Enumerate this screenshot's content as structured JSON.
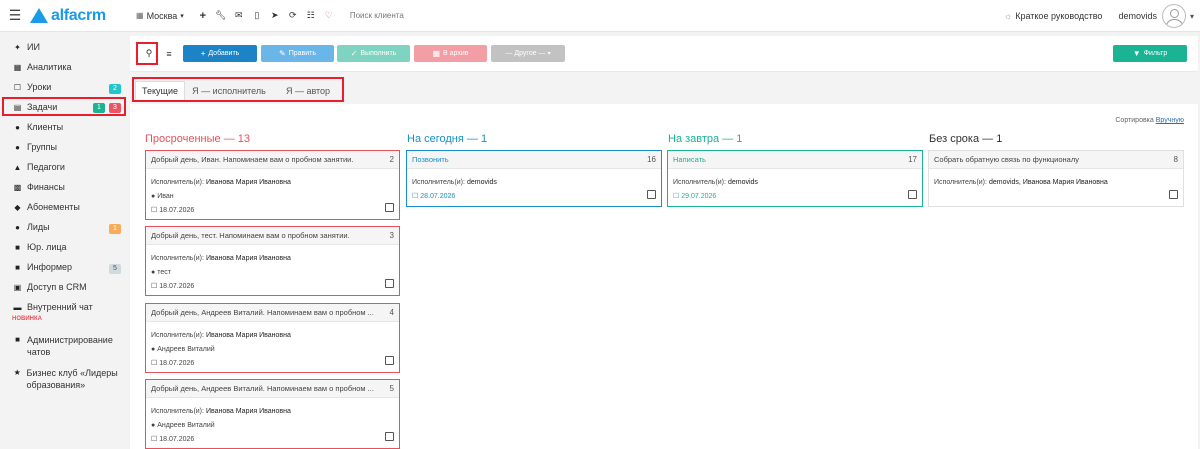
{
  "topbar": {
    "logo_text": "alfacrm",
    "city": "Москва",
    "search_placeholder": "Поиск клиента",
    "guide_label": "Краткое руководство",
    "username": "demovids",
    "icons": [
      "plus-icon",
      "wrench-icon",
      "mail-icon",
      "mobile-icon",
      "send-icon",
      "refresh-icon",
      "cart-icon",
      "bell-icon"
    ]
  },
  "sidebar": {
    "items": [
      {
        "label": "ИИ",
        "icon": "sparkle-icon"
      },
      {
        "label": "Аналитика",
        "icon": "chart-icon"
      },
      {
        "label": "Уроки",
        "icon": "calendar-icon",
        "badges": [
          "2"
        ]
      },
      {
        "label": "Задачи",
        "icon": "tasks-icon",
        "badges": [
          "1",
          "3"
        ]
      },
      {
        "label": "Клиенты",
        "icon": "user-icon"
      },
      {
        "label": "Группы",
        "icon": "users-icon"
      },
      {
        "label": "Педагоги",
        "icon": "graduation-icon"
      },
      {
        "label": "Финансы",
        "icon": "money-icon"
      },
      {
        "label": "Абонементы",
        "icon": "tag-icon"
      },
      {
        "label": "Лиды",
        "icon": "user-plus-icon",
        "badges": [
          "1"
        ]
      },
      {
        "label": "Юр. лица",
        "icon": "briefcase-icon"
      },
      {
        "label": "Информер",
        "icon": "message-icon",
        "badges": [
          "5"
        ]
      },
      {
        "label": "Доступ в CRM",
        "icon": "lock-icon"
      },
      {
        "label": "Внутренний чат",
        "icon": "chat-icon",
        "tag": "НОВИНКА"
      },
      {
        "label": "Администрирование чатов",
        "icon": "comments-icon"
      },
      {
        "label": "Бизнес клуб «Лидеры образования»",
        "icon": "star-icon"
      }
    ],
    "colors": {
      "teal": "#23c6c8",
      "green": "#1ab394",
      "red": "#ed5565",
      "orange": "#f8ac59",
      "gray": "#d1dade"
    }
  },
  "toolbar": {
    "add_label": "Добавить",
    "edit_label": "Править",
    "done_label": "Выполнить",
    "archive_label": "В архив",
    "other_label": "— Другое —",
    "filter_label": "Фильтр"
  },
  "tabs": [
    {
      "label": "Текущие",
      "active": true
    },
    {
      "label": "Я — исполнитель",
      "active": false
    },
    {
      "label": "Я — автор",
      "active": false
    }
  ],
  "sort": {
    "label": "Сортировка",
    "value": "Вручную"
  },
  "columns": [
    {
      "title": "Просроченные — 13",
      "color": "#e8505b",
      "cards": [
        {
          "title": "Добрый день, Иван. Напоминаем вам о пробном занятии.",
          "num": "2",
          "exec_label": "Исполнитель(и):",
          "exec": "Иванова Мария Ивановна",
          "client": "Иван",
          "date": "18.07.2026"
        },
        {
          "title": "Добрый день, тест. Напоминаем вам о пробном занятии.",
          "num": "3",
          "exec_label": "Исполнитель(и):",
          "exec": "Иванова Мария Ивановна",
          "client": "тест",
          "date": "18.07.2026"
        },
        {
          "title": "Добрый день, Андреев Виталий. Напоминаем вам о пробном ...",
          "num": "4",
          "exec_label": "Исполнитель(и):",
          "exec": "Иванова Мария Ивановна",
          "client": "Андреев Виталий",
          "date": "18.07.2026"
        },
        {
          "title": "Добрый день, Андреев Виталий. Напоминаем вам о пробном ...",
          "num": "5",
          "exec_label": "Исполнитель(и):",
          "exec": "Иванова Мария Ивановна",
          "client": "Андреев Виталий",
          "date": "18.07.2026"
        }
      ]
    },
    {
      "title": "На сегодня — 1",
      "color": "#1a8fc9",
      "cards": [
        {
          "title": "Позвонить",
          "num": "16",
          "exec_label": "Исполнитель(и):",
          "exec": "demovids",
          "date": "28.07.2026"
        }
      ]
    },
    {
      "title": "На завтра — 1",
      "color": "#1ab394",
      "cards": [
        {
          "title": "Написать",
          "num": "17",
          "exec_label": "Исполнитель(и):",
          "exec": "demovids",
          "date": "29.07.2026"
        }
      ]
    },
    {
      "title": "Без срока — 1",
      "color": "#333333",
      "cards": [
        {
          "title": "Собрать обратную связь по функционалу",
          "num": "8",
          "exec_label": "Исполнитель(и):",
          "exec": "demovids, Иванова Мария Ивановна"
        }
      ]
    }
  ]
}
